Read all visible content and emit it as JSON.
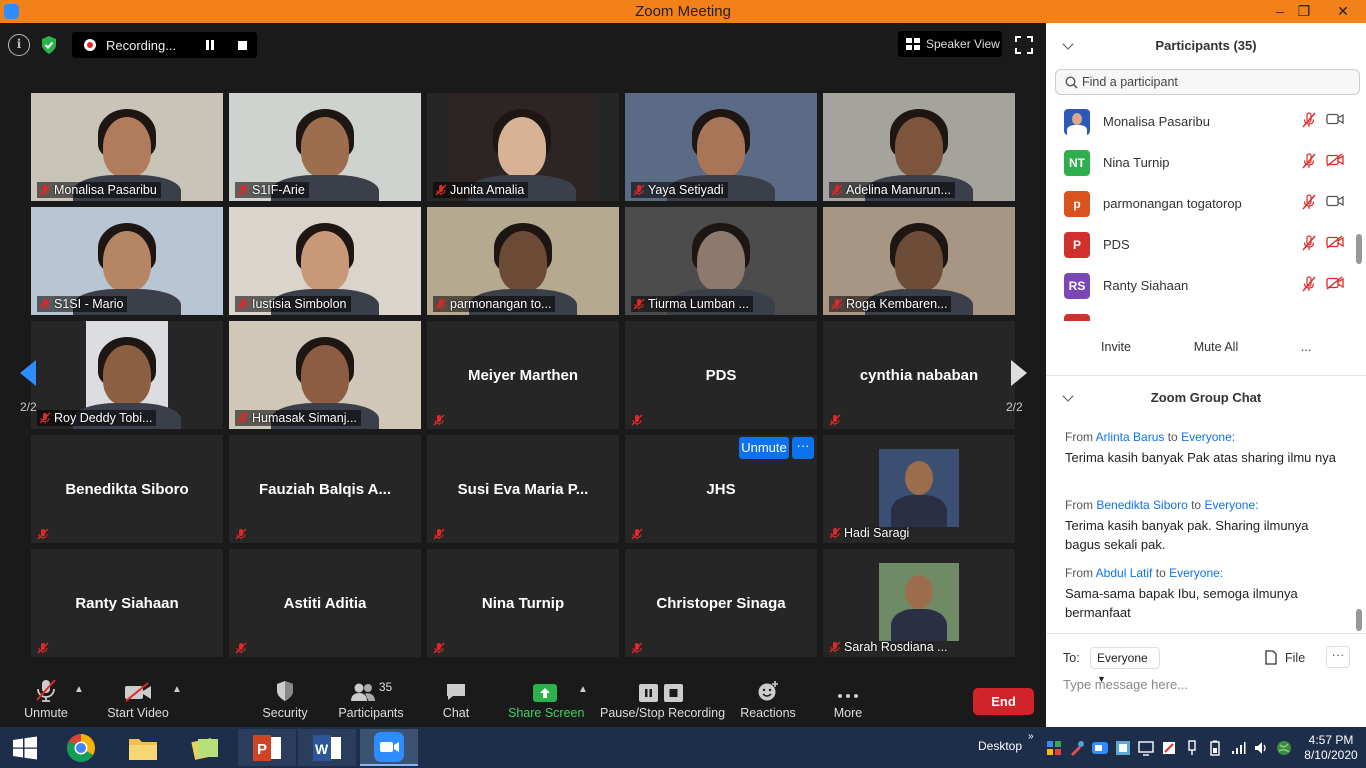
{
  "window": {
    "title": "Zoom Meeting",
    "minimize": "–",
    "restore": "❐",
    "close": "✕"
  },
  "topbar": {
    "recording_label": "Recording...",
    "view_label": "Speaker View"
  },
  "colors": {
    "accent": "#0e72ed",
    "title_bar": "#f3811a",
    "end": "#d2232a",
    "mute": "#e02828"
  },
  "grid": {
    "tiles": [
      {
        "name": "Monalisa Pasaribu",
        "video": true,
        "bg": "#c9c4b8",
        "skin": "#b07c5b"
      },
      {
        "name": "S1IF-Arie",
        "video": true,
        "bg": "#cfd3cf",
        "skin": "#9c6e4e"
      },
      {
        "name": "Junita Amalia",
        "video": true,
        "bg": "#2d2424",
        "skin": "#d8b294"
      },
      {
        "name": "Yaya Setiyadi",
        "video": true,
        "bg": "#5b6b86",
        "skin": "#a87656"
      },
      {
        "name": "Adelina Manurun...",
        "video": true,
        "bg": "#a4a39d",
        "skin": "#7c553c"
      },
      {
        "name": "S1SI - Mario",
        "video": true,
        "bg": "#b7c6d2",
        "skin": "#b68664"
      },
      {
        "name": "Iustisia Simbolon",
        "video": true,
        "bg": "#d9d5cc",
        "skin": "#c89878"
      },
      {
        "name": "parmonangan to...",
        "video": true,
        "bg": "#b5a990",
        "skin": "#6b4b36"
      },
      {
        "name": "Tiurma Lumban ...",
        "video": true,
        "bg": "#4c4c4c",
        "skin": "#8d7a6c"
      },
      {
        "name": "Roga Kembaren...",
        "video": true,
        "bg": "#a69683",
        "skin": "#6d4d38"
      },
      {
        "name": "Roy Deddy Tobi...",
        "video": true,
        "bg": "#dcdde0",
        "skin": "#8d5f42"
      },
      {
        "name": "Humasak Simanj...",
        "video": true,
        "bg": "#cfc7b7",
        "skin": "#8c5d43"
      },
      {
        "name": "Meiyer Marthen",
        "video": false
      },
      {
        "name": "PDS",
        "video": false
      },
      {
        "name": "cynthia nababan",
        "video": false
      },
      {
        "name": "Benedikta Siboro",
        "video": false
      },
      {
        "name": "Fauziah Balqis A...",
        "video": false
      },
      {
        "name": "Susi Eva Maria P...",
        "video": false
      },
      {
        "name": "JHS",
        "video": false
      },
      {
        "name": "Hadi Saragi",
        "video": "photo",
        "bg": "#3a4f72",
        "skin": "#9b6d4d"
      },
      {
        "name": "Ranty Siahaan",
        "video": false
      },
      {
        "name": "Astiti Aditia",
        "video": false
      },
      {
        "name": "Nina Turnip",
        "video": false
      },
      {
        "name": "Christoper Sinaga",
        "video": false
      },
      {
        "name": "Sarah Rosdiana ...",
        "video": "photo",
        "bg": "#6f8b66",
        "skin": "#9b6d4d"
      }
    ],
    "page_left": "2/2",
    "page_right": "2/2",
    "unmute_label": "Unmute",
    "more_label": "···"
  },
  "toolbar": {
    "unmute": "Unmute",
    "start_video": "Start Video",
    "security": "Security",
    "participants": "Participants",
    "participants_count": "35",
    "chat": "Chat",
    "share": "Share Screen",
    "pause_rec": "Pause/Stop Recording",
    "reactions": "Reactions",
    "more": "More",
    "end": "End"
  },
  "participants": {
    "title": "Participants (35)",
    "search_placeholder": "Find a participant",
    "list": [
      {
        "name": "Monalisa Pasaribu",
        "initials": "",
        "color": "#2d5ab8",
        "video_off": false
      },
      {
        "name": "Nina Turnip",
        "initials": "NT",
        "color": "#2fae4f",
        "video_off": true
      },
      {
        "name": "parmonangan togatorop",
        "initials": "p",
        "color": "#d9531e",
        "video_off": false
      },
      {
        "name": "PDS",
        "initials": "P",
        "color": "#d0312d",
        "video_off": true
      },
      {
        "name": "Ranty Siahaan",
        "initials": "RS",
        "color": "#7b47b5",
        "video_off": true
      }
    ],
    "invite": "Invite",
    "mute_all": "Mute All",
    "more": "..."
  },
  "chat": {
    "title": "Zoom Group Chat",
    "from_word": "From",
    "to_word": "to",
    "messages": [
      {
        "from": "Arlinta Barus",
        "to": "Everyone:",
        "text": "Terima kasih banyak Pak atas sharing ilmu nya"
      },
      {
        "from": "Benedikta Siboro",
        "to": "Everyone:",
        "text": "Terima kasih banyak pak. Sharing ilmunya bagus sekali pak."
      },
      {
        "from": "Abdul Latif",
        "to": "Everyone:",
        "text": "Sama-sama bapak Ibu, semoga ilmunya bermanfaat"
      }
    ],
    "to_label": "To:",
    "recipient": "Everyone",
    "file": "File",
    "more": "···",
    "input_placeholder": "Type message here..."
  },
  "taskbar": {
    "desktop": "Desktop",
    "time": "4:57 PM",
    "date": "8/10/2020"
  }
}
